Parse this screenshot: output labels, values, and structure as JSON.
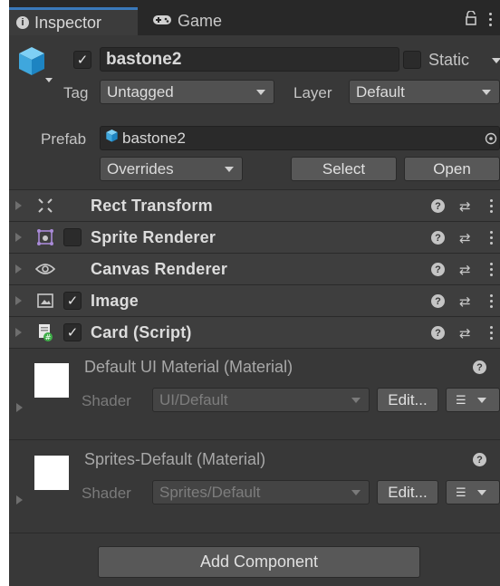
{
  "tabs": [
    {
      "label": "Inspector",
      "icon": "info-icon",
      "active": true
    },
    {
      "label": "Game",
      "icon": "gamepad-icon",
      "active": false
    }
  ],
  "gameobject": {
    "name": "bastone2",
    "active_checked": true,
    "static_label": "Static",
    "tag_label": "Tag",
    "tag_value": "Untagged",
    "layer_label": "Layer",
    "layer_value": "Default",
    "prefab_label": "Prefab",
    "prefab_value": "bastone2",
    "overrides_label": "Overrides",
    "select_label": "Select",
    "open_label": "Open"
  },
  "components": [
    {
      "title": "Rect Transform",
      "icon": "rect-transform-icon",
      "has_checkbox": false
    },
    {
      "title": "Sprite Renderer",
      "icon": "sprite-renderer-icon",
      "has_checkbox": true,
      "checked": false
    },
    {
      "title": "Canvas Renderer",
      "icon": "eye-icon",
      "has_checkbox": false
    },
    {
      "title": "Image",
      "icon": "image-icon",
      "has_checkbox": true,
      "checked": true
    },
    {
      "title": "Card (Script)",
      "icon": "script-icon",
      "has_checkbox": true,
      "checked": true
    }
  ],
  "materials": [
    {
      "title": "Default UI Material (Material)",
      "shader_label": "Shader",
      "shader_value": "UI/Default",
      "edit_label": "Edit..."
    },
    {
      "title": "Sprites-Default (Material)",
      "shader_label": "Shader",
      "shader_value": "Sprites/Default",
      "edit_label": "Edit..."
    }
  ],
  "add_component_label": "Add Component",
  "colors": {
    "panel_bg": "#383838",
    "tab_accent": "#3a79bb",
    "field_bg": "#2a2a2a",
    "button_bg": "#585858"
  }
}
